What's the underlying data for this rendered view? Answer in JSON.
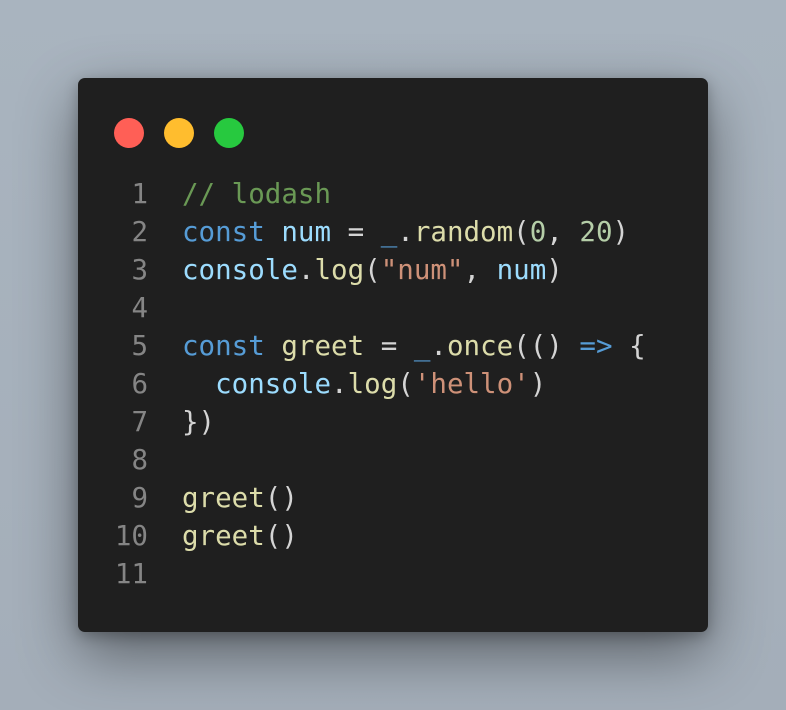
{
  "window": {
    "controls": [
      {
        "name": "close",
        "color": "#ff5f56"
      },
      {
        "name": "minimize",
        "color": "#ffbd2e"
      },
      {
        "name": "maximize",
        "color": "#27c93f"
      }
    ]
  },
  "colors": {
    "background": "#a9b4bf",
    "editor": "#1f1f1f",
    "line_number": "#858585",
    "comment": "#6a9955",
    "keyword": "#569cd6",
    "variable": "#9cdcfe",
    "function": "#dcdcaa",
    "string": "#ce9178",
    "number": "#b5cea8",
    "plain": "#d4d4d4"
  },
  "code_lines": [
    {
      "number": "1",
      "tokens": [
        {
          "text": "// lodash",
          "kind": "comment"
        }
      ]
    },
    {
      "number": "2",
      "tokens": [
        {
          "text": "const",
          "kind": "keyword"
        },
        {
          "text": " ",
          "kind": "plain"
        },
        {
          "text": "num",
          "kind": "variable"
        },
        {
          "text": " = ",
          "kind": "plain"
        },
        {
          "text": "_",
          "kind": "keyword"
        },
        {
          "text": ".",
          "kind": "plain"
        },
        {
          "text": "random",
          "kind": "function"
        },
        {
          "text": "(",
          "kind": "plain"
        },
        {
          "text": "0",
          "kind": "number"
        },
        {
          "text": ", ",
          "kind": "plain"
        },
        {
          "text": "20",
          "kind": "number"
        },
        {
          "text": ")",
          "kind": "plain"
        }
      ]
    },
    {
      "number": "3",
      "tokens": [
        {
          "text": "console",
          "kind": "variable"
        },
        {
          "text": ".",
          "kind": "plain"
        },
        {
          "text": "log",
          "kind": "function"
        },
        {
          "text": "(",
          "kind": "plain"
        },
        {
          "text": "\"num\"",
          "kind": "string"
        },
        {
          "text": ", ",
          "kind": "plain"
        },
        {
          "text": "num",
          "kind": "variable"
        },
        {
          "text": ")",
          "kind": "plain"
        }
      ]
    },
    {
      "number": "4",
      "tokens": []
    },
    {
      "number": "5",
      "tokens": [
        {
          "text": "const",
          "kind": "keyword"
        },
        {
          "text": " ",
          "kind": "plain"
        },
        {
          "text": "greet",
          "kind": "function"
        },
        {
          "text": " = ",
          "kind": "plain"
        },
        {
          "text": "_",
          "kind": "keyword"
        },
        {
          "text": ".",
          "kind": "plain"
        },
        {
          "text": "once",
          "kind": "function"
        },
        {
          "text": "(() ",
          "kind": "plain"
        },
        {
          "text": "=>",
          "kind": "keyword"
        },
        {
          "text": " {",
          "kind": "plain"
        }
      ]
    },
    {
      "number": "6",
      "tokens": [
        {
          "text": "  ",
          "kind": "plain"
        },
        {
          "text": "console",
          "kind": "variable"
        },
        {
          "text": ".",
          "kind": "plain"
        },
        {
          "text": "log",
          "kind": "function"
        },
        {
          "text": "(",
          "kind": "plain"
        },
        {
          "text": "'hello'",
          "kind": "string"
        },
        {
          "text": ")",
          "kind": "plain"
        }
      ]
    },
    {
      "number": "7",
      "tokens": [
        {
          "text": "})",
          "kind": "plain"
        }
      ]
    },
    {
      "number": "8",
      "tokens": []
    },
    {
      "number": "9",
      "tokens": [
        {
          "text": "greet",
          "kind": "function"
        },
        {
          "text": "()",
          "kind": "plain"
        }
      ]
    },
    {
      "number": "10",
      "tokens": [
        {
          "text": "greet",
          "kind": "function"
        },
        {
          "text": "()",
          "kind": "plain"
        }
      ]
    },
    {
      "number": "11",
      "tokens": []
    }
  ]
}
